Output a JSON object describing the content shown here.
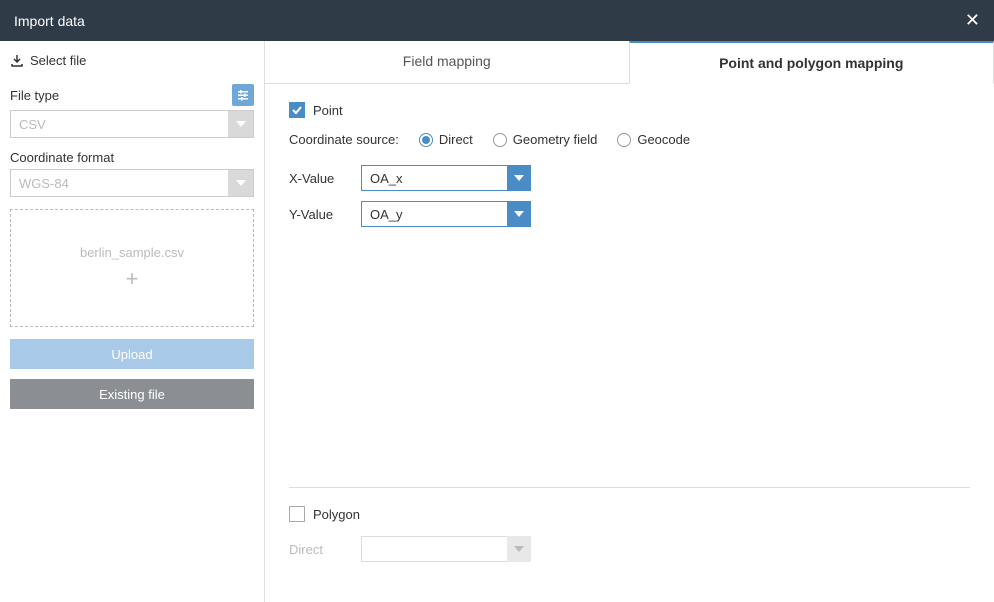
{
  "header": {
    "title": "Import data"
  },
  "sidebar": {
    "select_file_label": "Select file",
    "file_type_label": "File type",
    "file_type_value": "CSV",
    "coord_format_label": "Coordinate format",
    "coord_format_value": "WGS-84",
    "dropzone_filename": "berlin_sample.csv",
    "upload_label": "Upload",
    "existing_label": "Existing file"
  },
  "tabs": {
    "field_mapping": "Field mapping",
    "point_polygon": "Point and polygon mapping"
  },
  "point": {
    "label": "Point",
    "coord_source_label": "Coordinate source:",
    "options": {
      "direct": "Direct",
      "geometry": "Geometry field",
      "geocode": "Geocode"
    },
    "x_label": "X-Value",
    "x_value": "OA_x",
    "y_label": "Y-Value",
    "y_value": "OA_y"
  },
  "polygon": {
    "label": "Polygon",
    "direct_label": "Direct",
    "direct_value": ""
  }
}
